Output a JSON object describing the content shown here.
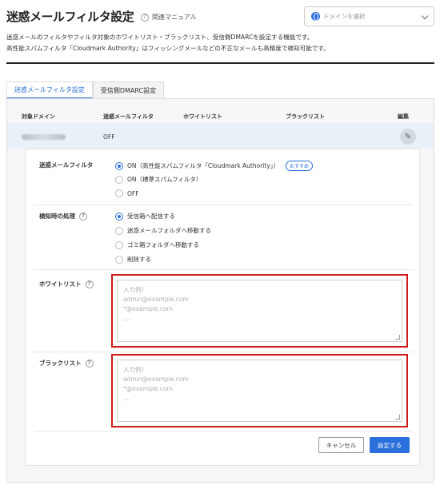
{
  "page": {
    "title": "迷惑メールフィルタ設定",
    "help_link": "関連マニュアル",
    "domain_placeholder": "ドメインを選択",
    "description_line1": "迷惑メールのフィルタやフィルタ対象のホワイトリスト・ブラックリスト、受信側DMARCを設定する機能です。",
    "description_line2": "高性能スパムフィルタ「Cloudmark Authority」はフィッシングメールなどの不正なメールも高精度で検知可能です。"
  },
  "tabs": [
    {
      "label": "迷惑メールフィルタ設定",
      "active": true
    },
    {
      "label": "受信側DMARC設定",
      "active": false
    }
  ],
  "table": {
    "headers": [
      "対象ドメイン",
      "迷惑メールフィルタ",
      "ホワイトリスト",
      "ブラックリスト",
      "編集"
    ],
    "row": {
      "filter_status": "OFF"
    }
  },
  "form": {
    "filter": {
      "label": "迷惑メールフィルタ",
      "options": [
        "ON（高性能スパムフィルタ「Cloudmark Authority」）",
        "ON（標準スパムフィルタ）",
        "OFF"
      ],
      "selected_index": 0,
      "recommended_badge": "おすすめ"
    },
    "action": {
      "label": "検知時の処理",
      "options": [
        "受信箱へ配信する",
        "迷惑メールフォルダへ移動する",
        "ゴミ箱フォルダへ移動する",
        "削除する"
      ],
      "selected_index": 0
    },
    "whitelist": {
      "label": "ホワイトリスト",
      "placeholder": "入力例)\nadmin@example.com\n*@example.com\n..."
    },
    "blacklist": {
      "label": "ブラックリスト",
      "placeholder": "入力例)\nadmin@example.com\n*@example.com\n..."
    },
    "cancel_label": "キャンセル",
    "save_label": "設定する"
  },
  "colors": {
    "accent": "#2a6fdb",
    "highlight_border": "#d01919"
  }
}
